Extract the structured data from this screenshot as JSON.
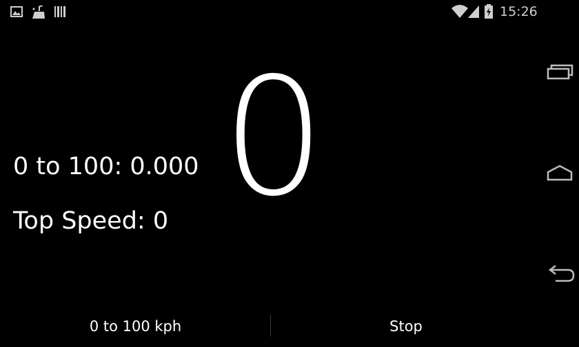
{
  "status_bar": {
    "time": "15:26",
    "notification_icons": [
      "gallery-icon",
      "cleaner-icon",
      "barcode-icon"
    ],
    "system_icons": [
      "wifi-icon",
      "signal-icon",
      "battery-charging-icon"
    ]
  },
  "main": {
    "speed_value": "0",
    "accel_text": "0 to 100: 0.000",
    "top_speed_text": "Top Speed: 0"
  },
  "buttons": {
    "mode_label": "0 to 100 kph",
    "stop_label": "Stop"
  },
  "nav_bar": {
    "icons": [
      "recent-apps-icon",
      "home-icon",
      "back-icon"
    ]
  },
  "colors": {
    "background": "#000000",
    "text": "#ffffff",
    "status_text": "#cfcfcf",
    "divider": "#3a3a3a"
  }
}
